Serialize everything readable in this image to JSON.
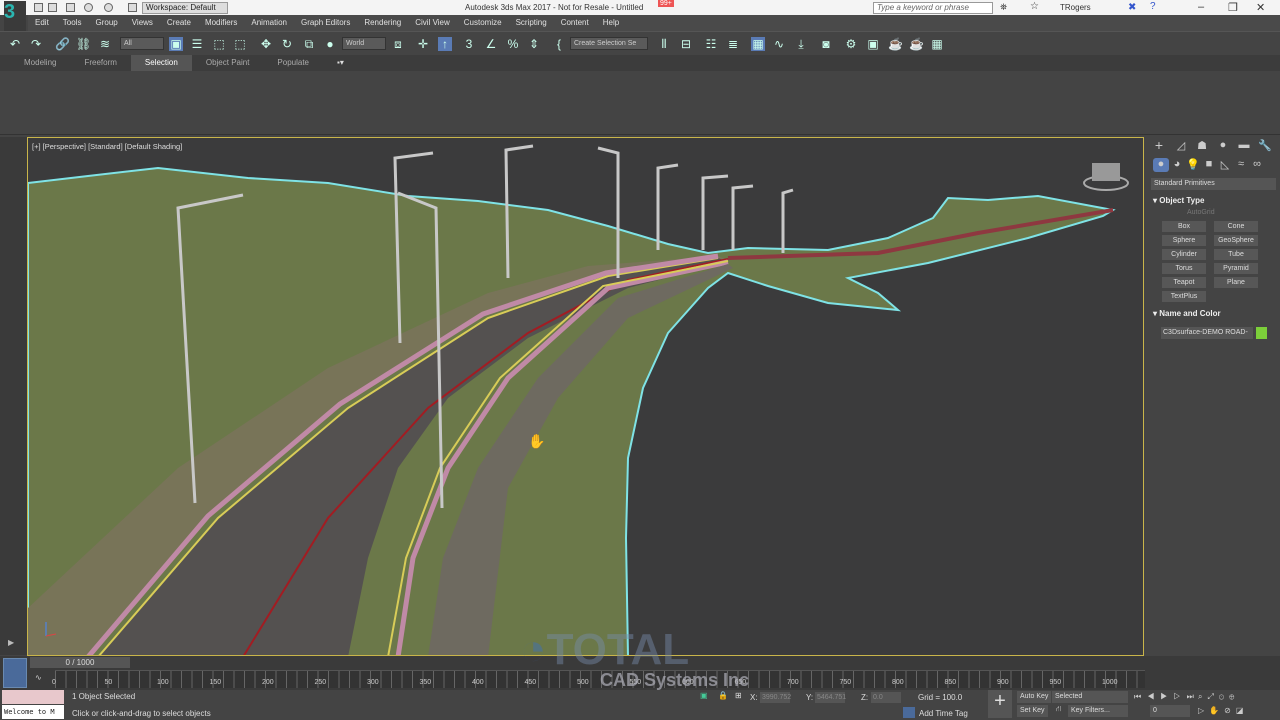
{
  "title_bar": {
    "app_title": "Autodesk 3ds Max 2017 - Not for Resale - Untitled",
    "workspace": "Workspace: Default",
    "notification_badge": "99+",
    "search_placeholder": "Type a keyword or phrase",
    "user": "TRogers",
    "logo": "3"
  },
  "menu": [
    "Edit",
    "Tools",
    "Group",
    "Views",
    "Create",
    "Modifiers",
    "Animation",
    "Graph Editors",
    "Rendering",
    "Civil View",
    "Customize",
    "Scripting",
    "Content",
    "Help"
  ],
  "toolbar": {
    "selection_filter": "All",
    "reference_coord": "World",
    "named_selection": "Create Selection Se"
  },
  "ribbon_tabs": [
    "Modeling",
    "Freeform",
    "Selection",
    "Object Paint",
    "Populate"
  ],
  "ribbon_active": "Selection",
  "viewport": {
    "label": "[+] [Perspective] [Standard] [Default Shading]"
  },
  "command_panel": {
    "category": "Standard Primitives",
    "object_type_title": "Object Type",
    "autogrid": "AutoGrid",
    "primitives": [
      "Box",
      "Cone",
      "Sphere",
      "GeoSphere",
      "Cylinder",
      "Tube",
      "Torus",
      "Pyramid",
      "Teapot",
      "Plane",
      "TextPlus"
    ],
    "name_color_title": "Name and Color",
    "object_name": "C3Dsurface-DEMO ROAD-",
    "object_color": "#7ccf3a"
  },
  "timeline": {
    "frame": "0 / 1000",
    "ticks": [
      "0",
      "50",
      "100",
      "150",
      "200",
      "250",
      "300",
      "350",
      "400",
      "450",
      "500",
      "550",
      "600",
      "650",
      "700",
      "750",
      "800",
      "850",
      "900",
      "950",
      "1000"
    ]
  },
  "status": {
    "selected": "1 Object Selected",
    "prompt": "Click or click-and-drag to select objects",
    "welcome": "Welcome to M",
    "x_label": "X:",
    "x": "3990.752",
    "y_label": "Y:",
    "y": "5464.751",
    "z_label": "Z:",
    "z": "0.0",
    "grid": "Grid = 100.0",
    "add_time_tag": "Add Time Tag",
    "auto_key": "Auto Key",
    "set_key": "Set Key",
    "key_mode": "Selected",
    "key_filters": "Key Filters...",
    "current_frame": "0"
  },
  "watermark": {
    "line1": "TOTAL",
    "line2": "CAD Systems Inc"
  }
}
